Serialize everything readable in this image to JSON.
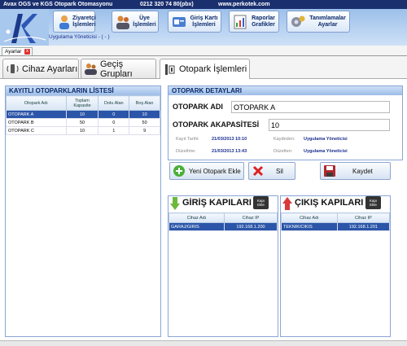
{
  "app": {
    "title": "Avax OGS ve KGS Otopark Otomasyonu",
    "phone": "0212 320 74 80(pbx)",
    "website": "www.perkotek.com",
    "user_line": "Uygulama Yöneticisi - ( - )"
  },
  "nav": [
    {
      "label": "Ziyaretçi\nİşlemleri",
      "icon": "visitor-icon"
    },
    {
      "label": "Üye\nİşlemleri",
      "icon": "members-icon"
    },
    {
      "label": "Giriş Kartı\nİşlemleri",
      "icon": "card-icon"
    },
    {
      "label": "Raporlar\nGrafikler",
      "icon": "report-icon"
    },
    {
      "label": "Tanımlamalar\nAyarlar",
      "icon": "settings-icon"
    }
  ],
  "doc_tab": {
    "label": "Ayarlar",
    "close": "x"
  },
  "tabs": [
    {
      "label": "Cihaz Ayarları",
      "icon": "device-icon"
    },
    {
      "label": "Geçiş Grupları",
      "icon": "group-icon"
    },
    {
      "label": "Otopark İşlemleri",
      "icon": "parking-icon"
    }
  ],
  "list_panel": {
    "title": "KAYITLI OTOPARKLARIN LİSTESİ",
    "columns": [
      "Otopark Adı",
      "Toplam\nKapasite",
      "Dolu Alan",
      "Boş Alan"
    ],
    "rows": [
      [
        "OTOPARK A",
        "10",
        "0",
        "10"
      ],
      [
        "OTOPARK B",
        "50",
        "0",
        "50"
      ],
      [
        "OTOPARK C",
        "10",
        "1",
        "9"
      ]
    ],
    "selected_row": 0
  },
  "detail_panel": {
    "title": "OTOPARK DETAYLARI",
    "name_label": "OTOPARK ADI",
    "name_value": "OTOPARK A",
    "capacity_label": "OTOPARK AKAPASİTESİ",
    "capacity_value": "10",
    "created_label": "Kayıt Tarihi:",
    "created_value": "21/03/2013 10:10",
    "created_by_label": "Kaydeden:",
    "created_by_value": "Uygulama Yöneticisi",
    "updated_label": "Düzeltme:",
    "updated_value": "21/03/2013 13:43",
    "updated_by_label": "Düzelten:",
    "updated_by_value": "Uygulama Yöneticisi"
  },
  "buttons": {
    "new": "Yeni Otopark Ekle",
    "delete": "Sil",
    "save": "Kaydet"
  },
  "entry_gates": {
    "title": "GİRİŞ KAPILARI",
    "add_button": "Kapı\nEkle",
    "columns": [
      "Cihaz Adı",
      "Cihaz IP"
    ],
    "rows": [
      [
        "GARAJ/GIRIS",
        "192.168.1.200"
      ]
    ]
  },
  "exit_gates": {
    "title": "ÇIKIŞ KAPILARI",
    "add_button": "Kapı\nEkle",
    "columns": [
      "Cihaz Adı",
      "Cihaz IP"
    ],
    "rows": [
      [
        "TEKNIK/CIKIS",
        "192.168.1.201"
      ]
    ]
  },
  "colors": {
    "title_bar": "#1a2f6e",
    "selection": "#2a55a8",
    "panel_header": "#9dbde8"
  }
}
